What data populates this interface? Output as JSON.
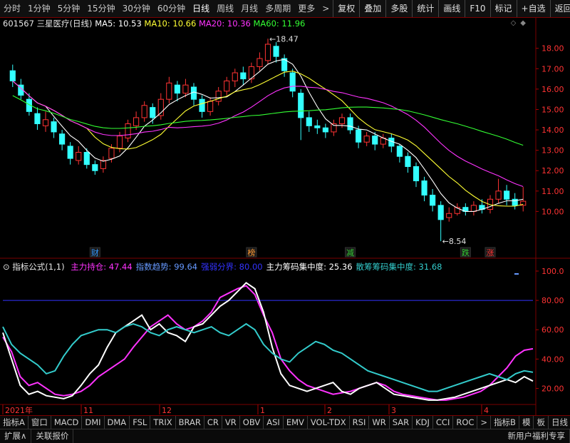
{
  "toolbar": {
    "tabs": [
      "分时",
      "1分钟",
      "5分钟",
      "15分钟",
      "30分钟",
      "60分钟",
      "日线",
      "周线",
      "月线",
      "多周期",
      "更多"
    ],
    "active_tab": "日线",
    "more_arrow": ">",
    "right_buttons": [
      "复权",
      "叠加",
      "多股",
      "统计",
      "画线",
      "F10",
      "标记",
      "+自选",
      "返回"
    ]
  },
  "stock": {
    "code": "601567",
    "name": "三星医疗(日线)"
  },
  "ma": {
    "ma5": "MA5: 10.53",
    "ma10": "MA10: 10.66",
    "ma20": "MA20: 10.36",
    "ma60": "MA60: 11.96"
  },
  "price_axis": {
    "labels": [
      "18.00",
      "17.00",
      "16.00",
      "15.00",
      "14.00",
      "13.00",
      "12.00",
      "11.00",
      "10.00"
    ]
  },
  "annotations": {
    "high": "18.47",
    "low": "8.54"
  },
  "markers": [
    {
      "text": "财",
      "color": "#3399ff"
    },
    {
      "text": "榜",
      "color": "#ff9933"
    },
    {
      "text": "减",
      "color": "#33cc33"
    },
    {
      "text": "跌",
      "color": "#33cc33"
    },
    {
      "text": "涨",
      "color": "#ff3333"
    }
  ],
  "indicator": {
    "name": "指标公式(1,1)",
    "items": [
      {
        "label": "主力持仓:",
        "value": "47.44",
        "color": "#ff33ff"
      },
      {
        "label": "指数趋势:",
        "value": "99.64",
        "color": "#6699ff"
      },
      {
        "label": "强弱分界:",
        "value": "80.00",
        "color": "#3333ff"
      },
      {
        "label": "主力筹码集中度:",
        "value": "25.36",
        "color": "#ffffff"
      },
      {
        "label": "散筹筹码集中度:",
        "value": "31.68",
        "color": "#33cccc"
      }
    ],
    "axis_labels": [
      "100.0",
      "80.00",
      "60.00",
      "40.00",
      "20.00"
    ]
  },
  "date_axis": {
    "labels": [
      "2021年",
      "11",
      "12",
      "1",
      "2",
      "3",
      "4"
    ]
  },
  "bottom_tabs": {
    "items": [
      "指标A",
      "窗口",
      "MACD",
      "DMI",
      "DMA",
      "FSL",
      "TRIX",
      "BRAR",
      "CR",
      "VR",
      "OBV",
      "ASI",
      "EMV",
      "VOL-TDX",
      "RSI",
      "WR",
      "SAR",
      "KDJ",
      "CCI",
      "ROC",
      ">",
      "指标B",
      "模",
      "板"
    ],
    "right": "日线"
  },
  "status": {
    "expand": "扩展∧",
    "related": "关联报价",
    "notice": "新用户福利专享"
  },
  "colors": {
    "up": "#ff3333",
    "down": "#33ffff",
    "ma5": "#ffffff",
    "ma10": "#ffff33",
    "ma20": "#ff33ff",
    "ma60": "#33ff33",
    "frame": "#7a0000"
  },
  "chart_data": [
    {
      "type": "candlestick",
      "title": "",
      "ylim": [
        8.3,
        18.9
      ],
      "x": [
        "2021-10",
        "2021-11",
        "2021-12",
        "2022-01",
        "2022-02",
        "2022-03",
        "2022-04"
      ],
      "ohlc_samples": [
        [
          16.9,
          16.4,
          17.2,
          16.1
        ],
        [
          16.2,
          15.7,
          16.5,
          15.5
        ],
        [
          15.5,
          14.9,
          15.8,
          14.7
        ],
        [
          14.8,
          14.3,
          15.1,
          14.0
        ],
        [
          14.2,
          14.5,
          14.9,
          13.9
        ],
        [
          14.4,
          13.9,
          14.6,
          13.6
        ],
        [
          13.8,
          13.3,
          14.0,
          13.0
        ],
        [
          13.2,
          12.6,
          13.4,
          12.3
        ],
        [
          12.5,
          12.9,
          13.2,
          12.3
        ],
        [
          12.9,
          12.3,
          13.1,
          12.1
        ],
        [
          12.3,
          12.0,
          12.5,
          11.8
        ],
        [
          12.1,
          12.5,
          12.7,
          11.9
        ],
        [
          12.6,
          13.1,
          13.3,
          12.4
        ],
        [
          13.1,
          13.7,
          13.9,
          12.9
        ],
        [
          13.6,
          14.3,
          14.5,
          13.4
        ],
        [
          14.2,
          14.6,
          14.9,
          14.0
        ],
        [
          14.6,
          15.2,
          15.4,
          14.4
        ],
        [
          15.1,
          14.6,
          15.3,
          14.3
        ],
        [
          14.7,
          15.5,
          15.8,
          14.5
        ],
        [
          15.5,
          16.3,
          16.6,
          15.3
        ],
        [
          16.2,
          15.8,
          16.4,
          15.4
        ],
        [
          15.8,
          16.2,
          16.5,
          15.6
        ],
        [
          16.1,
          15.5,
          16.3,
          15.2
        ],
        [
          15.5,
          14.9,
          15.7,
          14.6
        ],
        [
          14.9,
          15.4,
          15.6,
          14.7
        ],
        [
          15.4,
          15.9,
          16.1,
          15.2
        ],
        [
          15.9,
          16.4,
          16.6,
          15.7
        ],
        [
          16.4,
          16.8,
          17.0,
          16.1
        ],
        [
          16.8,
          16.5,
          17.1,
          16.2
        ],
        [
          16.5,
          17.1,
          17.3,
          16.3
        ],
        [
          17.1,
          17.5,
          17.8,
          16.9
        ],
        [
          17.4,
          18.2,
          18.47,
          17.2
        ],
        [
          18.1,
          17.6,
          18.3,
          17.3
        ],
        [
          17.5,
          16.9,
          17.7,
          16.6
        ],
        [
          16.8,
          15.9,
          17.0,
          15.6
        ],
        [
          15.8,
          14.6,
          16.0,
          13.5
        ],
        [
          14.6,
          14.2,
          14.9,
          13.9
        ],
        [
          14.2,
          14.1,
          14.5,
          13.8
        ],
        [
          14.1,
          13.9,
          14.3,
          13.6
        ],
        [
          13.9,
          14.3,
          14.5,
          13.7
        ],
        [
          14.3,
          14.6,
          14.8,
          14.1
        ],
        [
          14.6,
          14.0,
          14.8,
          13.8
        ],
        [
          14.0,
          13.4,
          14.2,
          13.1
        ],
        [
          13.4,
          13.7,
          13.9,
          13.2
        ],
        [
          13.7,
          13.3,
          13.9,
          13.0
        ],
        [
          13.3,
          13.6,
          13.8,
          13.1
        ],
        [
          13.6,
          13.2,
          13.8,
          12.9
        ],
        [
          13.2,
          12.7,
          13.3,
          12.4
        ],
        [
          12.7,
          12.2,
          12.9,
          11.9
        ],
        [
          12.2,
          11.5,
          12.4,
          11.2
        ],
        [
          11.5,
          10.8,
          11.7,
          10.5
        ],
        [
          10.8,
          10.3,
          11.1,
          10.0
        ],
        [
          10.3,
          9.6,
          10.5,
          8.54
        ],
        [
          9.7,
          9.9,
          10.2,
          9.5
        ],
        [
          9.9,
          10.2,
          10.4,
          9.8
        ],
        [
          10.2,
          10.0,
          10.4,
          9.8
        ],
        [
          10.0,
          10.3,
          10.5,
          9.8
        ],
        [
          10.3,
          10.1,
          10.6,
          9.9
        ],
        [
          10.1,
          10.6,
          10.8,
          9.9
        ],
        [
          10.6,
          11.0,
          11.6,
          10.4
        ],
        [
          11.0,
          10.6,
          11.3,
          10.3
        ],
        [
          10.6,
          10.3,
          10.9,
          10.1
        ],
        [
          10.3,
          10.5,
          11.2,
          10.0
        ]
      ]
    },
    {
      "type": "line",
      "title": "",
      "ylim": [
        10,
        100
      ],
      "series": [
        {
          "name": "主力持仓",
          "values": [
            55,
            45,
            28,
            22,
            24,
            20,
            16,
            15,
            16,
            18,
            22,
            28,
            32,
            36,
            40,
            48,
            55,
            62,
            66,
            70,
            64,
            60,
            62,
            66,
            72,
            82,
            85,
            88,
            90,
            84,
            70,
            58,
            40,
            32,
            26,
            22,
            20,
            18,
            16,
            17,
            18,
            20,
            22,
            24,
            22,
            18,
            16,
            15,
            14,
            13,
            12,
            12,
            13,
            14,
            16,
            18,
            22,
            28,
            34,
            42,
            46,
            47
          ]
        },
        {
          "name": "强弱分界",
          "values": [
            80,
            80,
            80,
            80,
            80,
            80,
            80,
            80,
            80,
            80,
            80,
            80,
            80,
            80,
            80,
            80,
            80,
            80,
            80,
            80,
            80,
            80,
            80,
            80,
            80,
            80,
            80,
            80,
            80,
            80,
            80,
            80,
            80,
            80,
            80,
            80,
            80,
            80,
            80,
            80,
            80,
            80,
            80,
            80,
            80,
            80,
            80,
            80,
            80,
            80,
            80,
            80,
            80,
            80,
            80,
            80,
            80,
            80,
            80,
            80,
            80,
            80
          ]
        },
        {
          "name": "主力筹码集中度",
          "values": [
            58,
            40,
            22,
            16,
            18,
            15,
            14,
            13,
            15,
            22,
            30,
            36,
            48,
            58,
            62,
            66,
            70,
            60,
            64,
            58,
            56,
            52,
            62,
            64,
            70,
            76,
            80,
            86,
            92,
            88,
            72,
            48,
            30,
            22,
            20,
            18,
            20,
            22,
            24,
            18,
            16,
            20,
            22,
            24,
            20,
            16,
            15,
            14,
            13,
            12,
            12,
            13,
            14,
            16,
            18,
            20,
            22,
            24,
            26,
            24,
            28,
            25
          ]
        },
        {
          "name": "散筹筹码集中度",
          "values": [
            62,
            50,
            44,
            40,
            36,
            30,
            32,
            42,
            50,
            56,
            58,
            60,
            60,
            58,
            62,
            64,
            62,
            58,
            56,
            60,
            62,
            60,
            58,
            60,
            62,
            58,
            56,
            60,
            64,
            60,
            50,
            44,
            40,
            38,
            44,
            48,
            52,
            50,
            46,
            44,
            40,
            36,
            32,
            30,
            28,
            26,
            24,
            22,
            20,
            18,
            18,
            20,
            22,
            24,
            26,
            28,
            30,
            28,
            26,
            30,
            32,
            31
          ]
        }
      ]
    }
  ]
}
